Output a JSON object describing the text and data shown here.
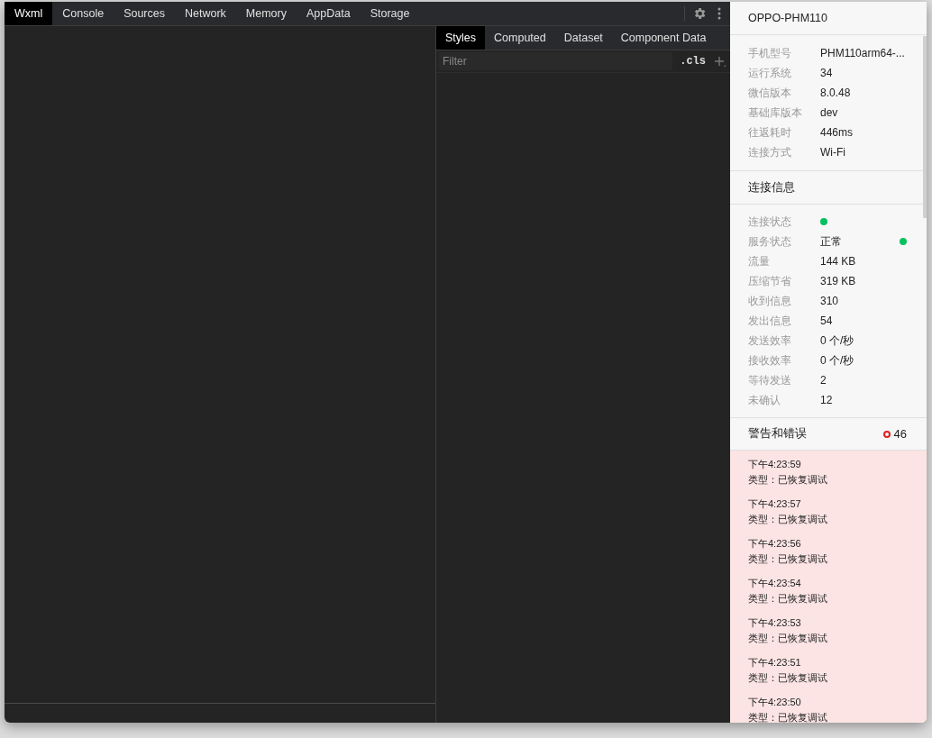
{
  "devtools": {
    "tabs": [
      {
        "label": "Wxml",
        "selected": true
      },
      {
        "label": "Console",
        "selected": false
      },
      {
        "label": "Sources",
        "selected": false
      },
      {
        "label": "Network",
        "selected": false
      },
      {
        "label": "Memory",
        "selected": false
      },
      {
        "label": "AppData",
        "selected": false
      },
      {
        "label": "Storage",
        "selected": false
      }
    ],
    "style_tabs": [
      {
        "label": "Styles",
        "selected": true
      },
      {
        "label": "Computed",
        "selected": false
      },
      {
        "label": "Dataset",
        "selected": false
      },
      {
        "label": "Component Data",
        "selected": false
      }
    ],
    "filter": {
      "placeholder": "Filter"
    },
    "cls_button": ".cls"
  },
  "device_panel": {
    "title": "OPPO-PHM110",
    "device_info": [
      {
        "label": "手机型号",
        "value": "PHM110arm64-..."
      },
      {
        "label": "运行系统",
        "value": "34"
      },
      {
        "label": "微信版本",
        "value": "8.0.48"
      },
      {
        "label": "基础库版本",
        "value": "dev"
      },
      {
        "label": "往返耗时",
        "value": "446ms"
      },
      {
        "label": "连接方式",
        "value": "Wi-Fi"
      }
    ],
    "connection_title": "连接信息",
    "connection_info": [
      {
        "kind": "dot",
        "label": "连接状态",
        "color": "#07c160"
      },
      {
        "kind": "text_dot",
        "label": "服务状态",
        "value": "正常",
        "color": "#07c160"
      },
      {
        "kind": "text",
        "label": "流量",
        "value": "144 KB"
      },
      {
        "kind": "text",
        "label": "压缩节省",
        "value": "319 KB"
      },
      {
        "kind": "text",
        "label": "收到信息",
        "value": "310"
      },
      {
        "kind": "text",
        "label": "发出信息",
        "value": "54"
      },
      {
        "kind": "text",
        "label": "发送效率",
        "value": "0 个/秒"
      },
      {
        "kind": "text",
        "label": "接收效率",
        "value": "0 个/秒"
      },
      {
        "kind": "text",
        "label": "等待发送",
        "value": "2"
      },
      {
        "kind": "text",
        "label": "未确认",
        "value": "12"
      }
    ],
    "warnings_title": "警告和错误",
    "warnings_count": "46",
    "logs": [
      {
        "time": "下午4:23:59",
        "type": "类型：已恢复调试"
      },
      {
        "time": "下午4:23:57",
        "type": "类型：已恢复调试"
      },
      {
        "time": "下午4:23:56",
        "type": "类型：已恢复调试"
      },
      {
        "time": "下午4:23:54",
        "type": "类型：已恢复调试"
      },
      {
        "time": "下午4:23:53",
        "type": "类型：已恢复调试"
      },
      {
        "time": "下午4:23:51",
        "type": "类型：已恢复调试"
      },
      {
        "time": "下午4:23:50",
        "type": "类型：已恢复调试"
      }
    ]
  }
}
